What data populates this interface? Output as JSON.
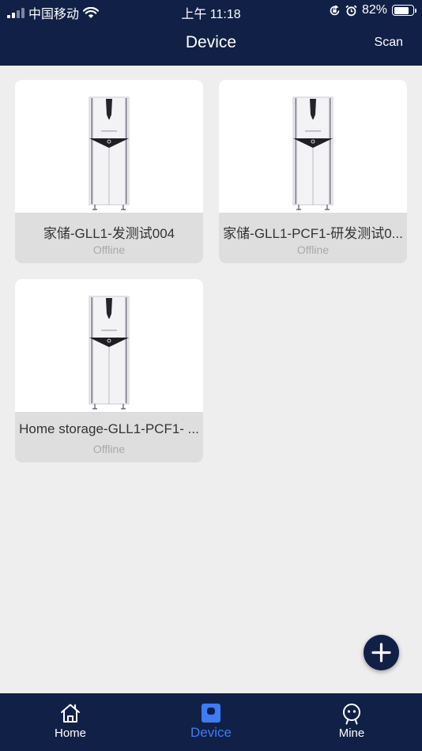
{
  "status_bar": {
    "carrier": "中国移动",
    "time": "上午 11:18",
    "battery_percent": "82%",
    "battery_level": 0.82,
    "icons": [
      "signal-icon",
      "wifi-icon",
      "orientation-lock-icon",
      "alarm-icon",
      "battery-icon"
    ]
  },
  "header": {
    "title": "Device",
    "scan_label": "Scan"
  },
  "devices": [
    {
      "name": "家储-GLL1-发测试004",
      "status": "Offline"
    },
    {
      "name": "家储-GLL1-PCF1-研发测试0...",
      "status": "Offline"
    },
    {
      "name": "Home storage-GLL1-PCF1- ...",
      "status": "Offline"
    }
  ],
  "fab": {
    "icon": "plus-icon"
  },
  "tabbar": {
    "active": "device",
    "tabs": [
      {
        "id": "home",
        "label": "Home",
        "icon": "home-icon"
      },
      {
        "id": "device",
        "label": "Device",
        "icon": "device-icon"
      },
      {
        "id": "mine",
        "label": "Mine",
        "icon": "robot-face-icon"
      }
    ]
  },
  "colors": {
    "header_bg": "#112046",
    "page_bg": "#eeeeee",
    "active_tab": "#3e7bf5",
    "status_offline": "#a9a9a9"
  }
}
